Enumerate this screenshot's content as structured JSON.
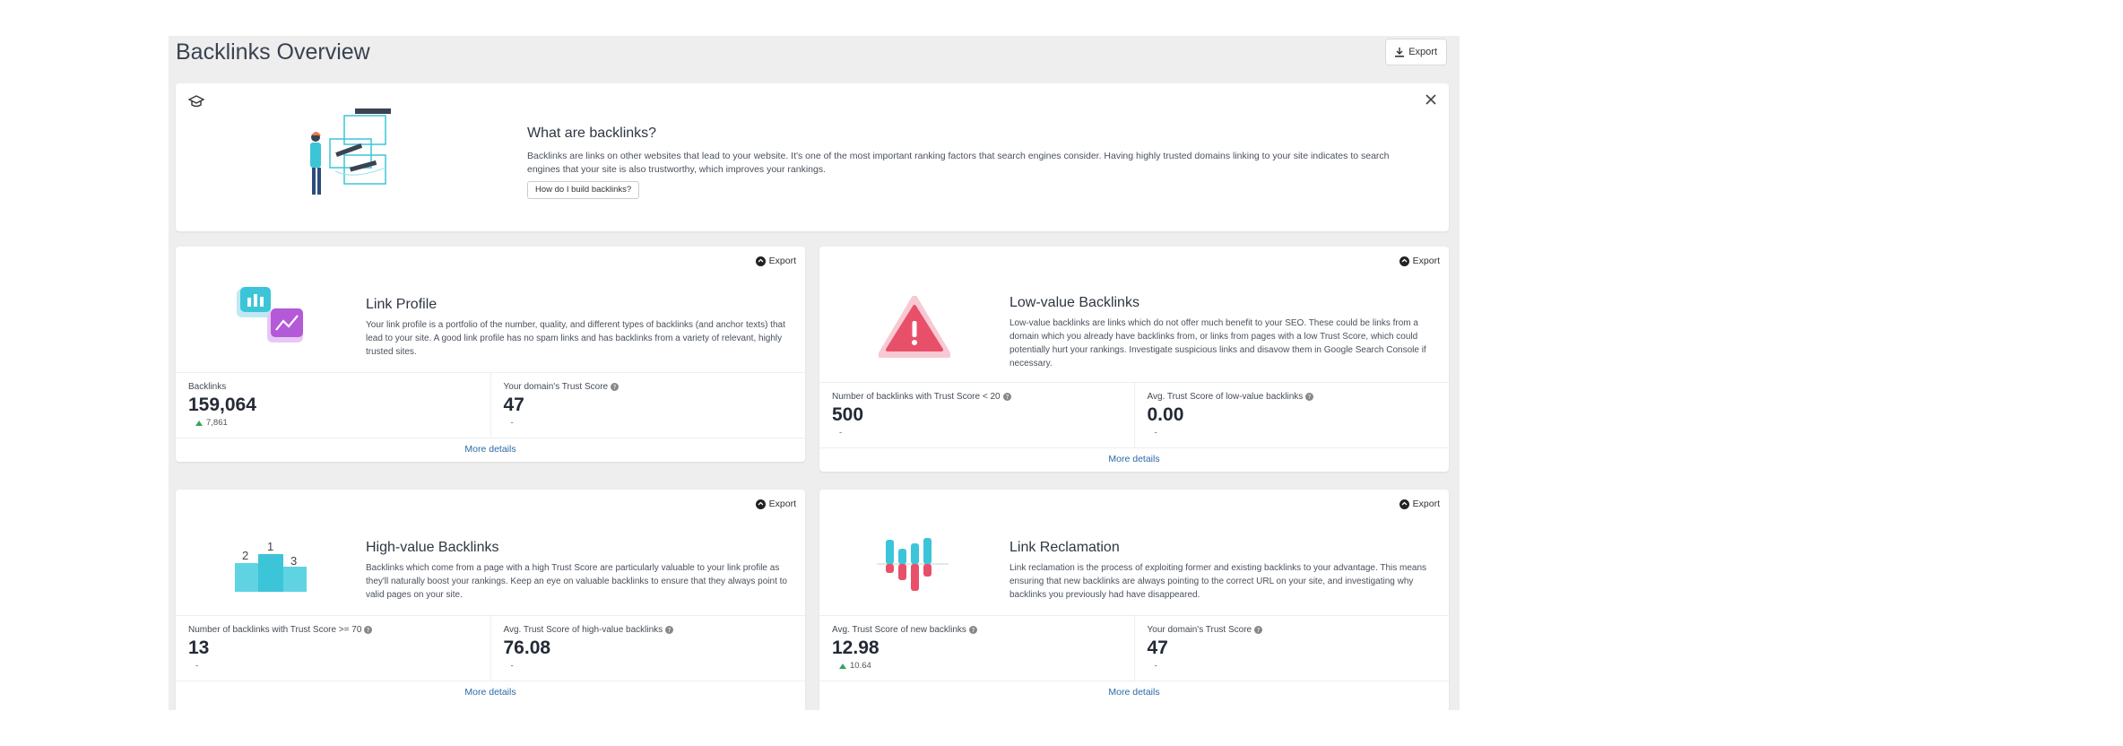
{
  "page": {
    "title": "Backlinks Overview",
    "export_label": "Export"
  },
  "intro": {
    "title": "What are backlinks?",
    "description": "Backlinks are links on other websites that lead to your website. It's one of the most important ranking factors that search engines consider. Having highly trusted domains linking to your site indicates to search engines that your site is also trustworthy, which improves your rankings.",
    "button_label": "How do I build backlinks?"
  },
  "cards": {
    "link_profile": {
      "export_label": "Export",
      "title": "Link Profile",
      "description": "Your link profile is a portfolio of the number, quality, and different types of backlinks (and anchor texts) that lead to your site. A good link profile has no spam links and has backlinks from a variety of relevant, highly trusted sites.",
      "metric1": {
        "label": "Backlinks",
        "value": "159,064",
        "delta": "7,861"
      },
      "metric2": {
        "label": "Your domain's Trust Score",
        "value": "47",
        "delta": "-"
      },
      "more": "More details"
    },
    "low_value": {
      "export_label": "Export",
      "title": "Low-value Backlinks",
      "description": "Low-value backlinks are links which do not offer much benefit to your SEO. These could be links from a domain which you already have backlinks from, or links from pages with a low Trust Score, which could potentially hurt your rankings. Investigate suspicious links and disavow them in Google Search Console if necessary.",
      "metric1": {
        "label": "Number of backlinks with Trust Score < 20",
        "value": "500",
        "delta": "-"
      },
      "metric2": {
        "label": "Avg. Trust Score of low-value backlinks",
        "value": "0.00",
        "delta": "-"
      },
      "more": "More details"
    },
    "high_value": {
      "export_label": "Export",
      "title": "High-value Backlinks",
      "description": "Backlinks which come from a page with a high Trust Score are particularly valuable to your link profile as they'll naturally boost your rankings. Keep an eye on valuable backlinks to ensure that they always point to valid pages on your site.",
      "podium": [
        "2",
        "1",
        "3"
      ],
      "metric1": {
        "label": "Number of backlinks with Trust Score >= 70",
        "value": "13",
        "delta": "-"
      },
      "metric2": {
        "label": "Avg. Trust Score of high-value backlinks",
        "value": "76.08",
        "delta": "-"
      },
      "more": "More details"
    },
    "reclamation": {
      "export_label": "Export",
      "title": "Link Reclamation",
      "description": "Link reclamation is the process of exploiting former and existing backlinks to your advantage. This means ensuring that new backlinks are always pointing to the correct URL on your site, and investigating why backlinks you previously had have disappeared.",
      "metric1": {
        "label": "Avg. Trust Score of new backlinks",
        "value": "12.98",
        "delta": "10.64"
      },
      "metric2": {
        "label": "Your domain's Trust Score",
        "value": "47",
        "delta": "-"
      },
      "more": "More details"
    }
  },
  "colors": {
    "accent": "#2a6aa8",
    "teal": "#3cc5d8",
    "pink": "#e8506a",
    "purple": "#b45ad8",
    "up": "#3aa35d"
  }
}
